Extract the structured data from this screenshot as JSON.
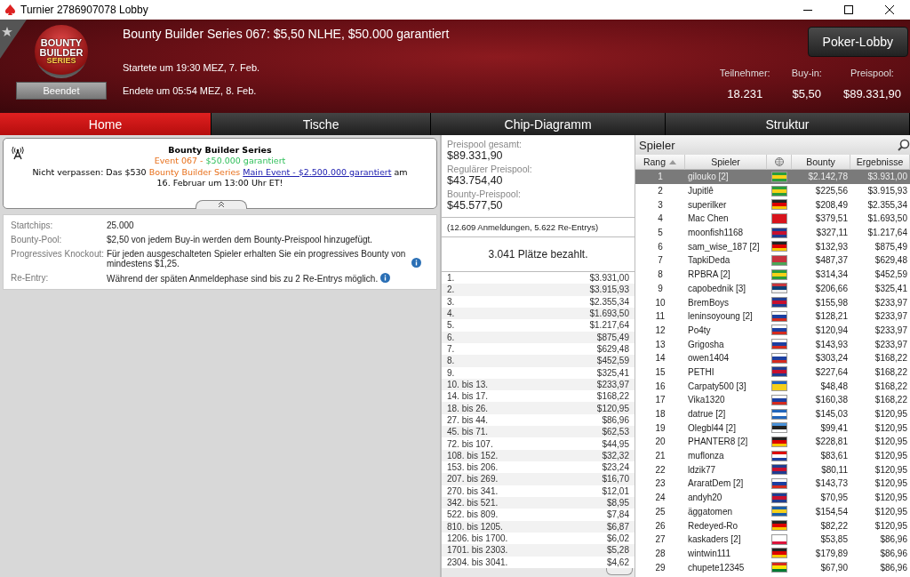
{
  "window": {
    "title": "Turnier 2786907078 Lobby"
  },
  "header": {
    "logo_lines": [
      "BOUNTY",
      "BUILDER",
      "SERIES"
    ],
    "status": "Beendet",
    "title": "Bounty Builder Series 067: $5,50 NLHE, $50.000 garantiert",
    "started": "Startete um 19:30 MEZ, 7. Feb.",
    "ended": "Endete um 05:54 MEZ, 8. Feb.",
    "lobby_button": "Poker-Lobby",
    "stats": [
      {
        "label": "Teilnehmer:",
        "value": "18.231"
      },
      {
        "label": "Buy-in:",
        "value": "$5,50"
      },
      {
        "label": "Preispool:",
        "value": "$89.331,90"
      }
    ]
  },
  "tabs": [
    {
      "label": "Home",
      "selected": true
    },
    {
      "label": "Tische",
      "selected": false
    },
    {
      "label": "Chip-Diagramm",
      "selected": false
    },
    {
      "label": "Struktur",
      "selected": false
    }
  ],
  "notice": {
    "title": "Bounty Builder Series",
    "event": "Event 067",
    "dash": " - ",
    "guarantee": "$50.000 garantiert",
    "message": [
      {
        "kind": "plain",
        "text": "Nicht verpassen: Das $530 "
      },
      {
        "kind": "highlight",
        "text": "Bounty Builder Series "
      },
      {
        "kind": "link",
        "text": "Main Event - $2.500.000 garantiert"
      },
      {
        "kind": "plain",
        "text": " am 16. Februar um 13:00 Uhr ET!"
      }
    ]
  },
  "details": [
    {
      "label": "Startchips:",
      "value": "25.000",
      "info": false
    },
    {
      "label": "Bounty-Pool:",
      "value": "$2,50 von jedem Buy-in werden dem Bounty-Preispool hinzugefügt.",
      "info": false
    },
    {
      "label": "Progressives Knockout:",
      "value": "Für jeden ausgeschalteten Spieler erhalten Sie ein progressives Bounty von mindestens $1,25.",
      "info": true
    },
    {
      "label": "Re-Entry:",
      "value": "Während der späten Anmeldephase sind bis zu 2 Re-Entrys möglich.",
      "info": true
    }
  ],
  "prizepool": {
    "pools": [
      {
        "label": "Preispool gesamt:",
        "value": "$89.331,90"
      },
      {
        "label": "Regulärer Preispool:",
        "value": "$43.754,40"
      },
      {
        "label": "Bounty-Preispool:",
        "value": "$45.577,50"
      }
    ],
    "entries": "(12.609 Anmeldungen, 5.622 Re-Entrys)",
    "paid": "3.041 Plätze bezahlt.",
    "payouts": [
      [
        "1.",
        "$3.931,00"
      ],
      [
        "2.",
        "$3.915,93"
      ],
      [
        "3.",
        "$2.355,34"
      ],
      [
        "4.",
        "$1.693,50"
      ],
      [
        "5.",
        "$1.217,64"
      ],
      [
        "6.",
        "$875,49"
      ],
      [
        "7.",
        "$629,48"
      ],
      [
        "8.",
        "$452,59"
      ],
      [
        "9.",
        "$325,41"
      ],
      [
        "10. bis 13.",
        "$233,97"
      ],
      [
        "14. bis 17.",
        "$168,22"
      ],
      [
        "18. bis 26.",
        "$120,95"
      ],
      [
        "27. bis 44.",
        "$86,96"
      ],
      [
        "45. bis 71.",
        "$62,53"
      ],
      [
        "72. bis 107.",
        "$44,95"
      ],
      [
        "108. bis 152.",
        "$32,32"
      ],
      [
        "153. bis 206.",
        "$23,24"
      ],
      [
        "207. bis 269.",
        "$16,70"
      ],
      [
        "270. bis 341.",
        "$12,01"
      ],
      [
        "342. bis 521.",
        "$8,95"
      ],
      [
        "522. bis 809.",
        "$7,84"
      ],
      [
        "810. bis 1205.",
        "$6,87"
      ],
      [
        "1206. bis 1700.",
        "$6,02"
      ],
      [
        "1701. bis 2303.",
        "$5,28"
      ],
      [
        "2304. bis 3041.",
        "$4,62"
      ]
    ]
  },
  "players": {
    "title": "Spieler",
    "columns": [
      "Rang",
      "Spieler",
      "Bounty",
      "Ergebnisse"
    ],
    "rows": [
      {
        "rank": "1",
        "name": "gilouko [2]",
        "kind": "br",
        "bounty": "$2.142,78",
        "result": "$3.931,00",
        "selected": true
      },
      {
        "rank": "2",
        "name": "Jupitlê",
        "kind": "br",
        "bounty": "$225,56",
        "result": "$3.915,93",
        "selected": false
      },
      {
        "rank": "3",
        "name": "superilker",
        "kind": "de",
        "bounty": "$208,49",
        "result": "$2.355,34",
        "selected": false
      },
      {
        "rank": "4",
        "name": "Mac Chen",
        "kind": "tw",
        "bounty": "$379,51",
        "result": "$1.693,50",
        "selected": false
      },
      {
        "rank": "5",
        "name": "moonfish1168",
        "kind": "gb",
        "bounty": "$327,11",
        "result": "$1.217,64",
        "selected": false
      },
      {
        "rank": "6",
        "name": "sam_wise_187 [2]",
        "kind": "de",
        "bounty": "$132,93",
        "result": "$875,49",
        "selected": false
      },
      {
        "rank": "7",
        "name": "TapkiDeda",
        "kind": "by",
        "bounty": "$487,37",
        "result": "$629,48",
        "selected": false
      },
      {
        "rank": "8",
        "name": "RPBRA [2]",
        "kind": "br",
        "bounty": "$314,34",
        "result": "$452,59",
        "selected": false
      },
      {
        "rank": "9",
        "name": "capobednik [3]",
        "kind": "rs",
        "bounty": "$206,66",
        "result": "$325,41",
        "selected": false
      },
      {
        "rank": "10",
        "name": "BremBoys",
        "kind": "gb",
        "bounty": "$155,98",
        "result": "$233,97",
        "selected": false
      },
      {
        "rank": "11",
        "name": "leninsoyoung [2]",
        "kind": "ru",
        "bounty": "$128,21",
        "result": "$233,97",
        "selected": false
      },
      {
        "rank": "12",
        "name": "Po4ty",
        "kind": "ru",
        "bounty": "$120,94",
        "result": "$233,97",
        "selected": false
      },
      {
        "rank": "13",
        "name": "Grigosha",
        "kind": "ru",
        "bounty": "$143,93",
        "result": "$233,97",
        "selected": false
      },
      {
        "rank": "14",
        "name": "owen1404",
        "kind": "ru",
        "bounty": "$303,24",
        "result": "$168,22",
        "selected": false
      },
      {
        "rank": "15",
        "name": "PETHI",
        "kind": "gb",
        "bounty": "$227,64",
        "result": "$168,22",
        "selected": false
      },
      {
        "rank": "16",
        "name": "Carpaty500 [3]",
        "kind": "ua",
        "bounty": "$48,48",
        "result": "$168,22",
        "selected": false
      },
      {
        "rank": "17",
        "name": "Vika1320",
        "kind": "ru",
        "bounty": "$160,38",
        "result": "$168,22",
        "selected": false
      },
      {
        "rank": "18",
        "name": "datrue [2]",
        "kind": "gr",
        "bounty": "$145,03",
        "result": "$120,95",
        "selected": false
      },
      {
        "rank": "19",
        "name": "Olegbl44 [2]",
        "kind": "ee",
        "bounty": "$99,41",
        "result": "$120,95",
        "selected": false
      },
      {
        "rank": "20",
        "name": "PHANTER8 [2]",
        "kind": "de",
        "bounty": "$228,81",
        "result": "$120,95",
        "selected": false
      },
      {
        "rank": "21",
        "name": "muflonza",
        "kind": "hr",
        "bounty": "$83,61",
        "result": "$120,95",
        "selected": false
      },
      {
        "rank": "22",
        "name": "ldzik77",
        "kind": "gb",
        "bounty": "$80,11",
        "result": "$120,95",
        "selected": false
      },
      {
        "rank": "23",
        "name": "AraratDem [2]",
        "kind": "ru",
        "bounty": "$143,73",
        "result": "$120,95",
        "selected": false
      },
      {
        "rank": "24",
        "name": "andyh20",
        "kind": "gb",
        "bounty": "$70,95",
        "result": "$120,95",
        "selected": false
      },
      {
        "rank": "25",
        "name": "äggatomen",
        "kind": "se",
        "bounty": "$154,54",
        "result": "$120,95",
        "selected": false
      },
      {
        "rank": "26",
        "name": "Redeyed-Ro",
        "kind": "de",
        "bounty": "$82,22",
        "result": "$120,95",
        "selected": false
      },
      {
        "rank": "27",
        "name": "kaskaders [2]",
        "kind": "pl",
        "bounty": "$53,85",
        "result": "$86,96",
        "selected": false
      },
      {
        "rank": "28",
        "name": "wintwin111",
        "kind": "de",
        "bounty": "$179,89",
        "result": "$86,96",
        "selected": false
      },
      {
        "rank": "29",
        "name": "chupete12345",
        "kind": "bo",
        "bounty": "$67,90",
        "result": "$86,96",
        "selected": false
      }
    ]
  }
}
